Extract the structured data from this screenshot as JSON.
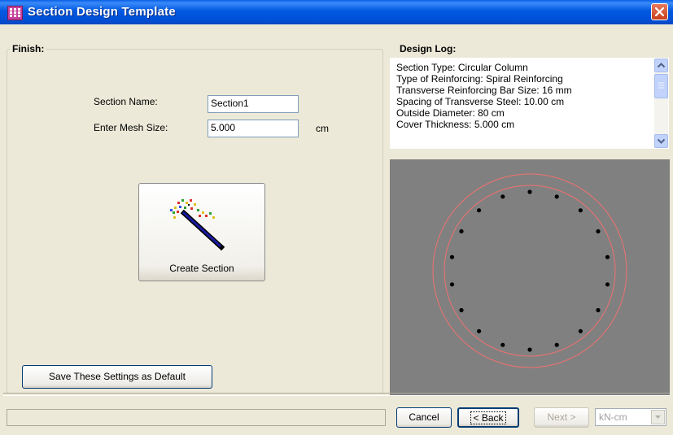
{
  "window": {
    "title": "Section Design Template",
    "icon": "grid-app-icon",
    "close_icon": "close-icon"
  },
  "finish_panel": {
    "title": "Finish:",
    "section_name_label": "Section Name:",
    "section_name_value": "Section1",
    "mesh_size_label": "Enter Mesh Size:",
    "mesh_size_value": "5.000",
    "mesh_size_unit": "cm",
    "create_section_label": "Create Section",
    "create_section_icon": "magic-wand-icon",
    "save_default_label": "Save These Settings as Default"
  },
  "design_log": {
    "title": "Design Log:",
    "lines": [
      "Section Type:  Circular Column",
      "Type of Reinforcing:  Spiral Reinforcing",
      "Transverse Reinforcing Bar Size:  16 mm",
      "Spacing of Transverse Steel:  10.00  cm",
      "Outside Diameter:  80  cm",
      "Cover Thickness:  5.000  cm"
    ]
  },
  "preview": {
    "background": "#808080",
    "circle_color": "#F07070",
    "bar_color": "#000000",
    "bar_count": 18
  },
  "footer": {
    "cancel_label": "Cancel",
    "back_label": "< Back",
    "next_label": "Next >",
    "units_value": "kN-cm"
  }
}
